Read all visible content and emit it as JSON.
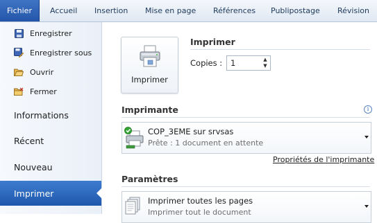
{
  "ribbon": {
    "tabs": [
      "Fichier",
      "Accueil",
      "Insertion",
      "Mise en page",
      "Références",
      "Publipostage",
      "Révision"
    ]
  },
  "nav": {
    "commands": [
      {
        "label": "Enregistrer",
        "icon": "save-icon"
      },
      {
        "label": "Enregistrer sous",
        "icon": "save-as-icon"
      },
      {
        "label": "Ouvrir",
        "icon": "open-folder-icon"
      },
      {
        "label": "Fermer",
        "icon": "close-folder-icon"
      }
    ],
    "tabs": [
      "Informations",
      "Récent",
      "Nouveau",
      "Imprimer"
    ],
    "active_tab": "Imprimer"
  },
  "print": {
    "heading": "Imprimer",
    "button_label": "Imprimer",
    "copies_label": "Copies :",
    "copies_value": "1"
  },
  "printer": {
    "heading": "Imprimante",
    "name": "COP_3EME sur srvsas",
    "status": "Prête : 1 document en attente",
    "properties_link": "Propriétés de l'imprimante"
  },
  "settings": {
    "heading": "Paramètres",
    "option_title": "Imprimer toutes les pages",
    "option_subtitle": "Imprimer tout le document"
  },
  "colors": {
    "file_tab": "#2356a8",
    "active_nav": "#2a66bd",
    "ribbon_text": "#1e395b"
  }
}
